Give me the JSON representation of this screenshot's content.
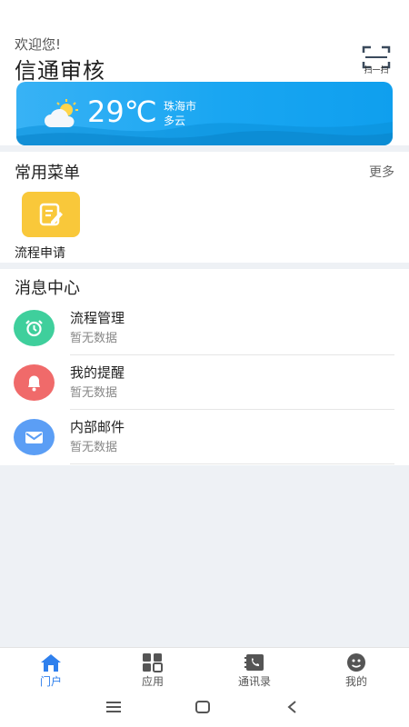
{
  "header": {
    "greeting": "欢迎您!",
    "title": "信通审核",
    "scan_label": "扫一扫"
  },
  "weather": {
    "temperature": "29℃",
    "city": "珠海市",
    "condition": "多云",
    "icon": "partly-cloudy-icon"
  },
  "menu_section": {
    "title": "常用菜单",
    "more_label": "更多",
    "items": [
      {
        "label": "流程申请",
        "icon": "edit-form-icon",
        "color": "#f9c83a"
      }
    ]
  },
  "message_section": {
    "title": "消息中心",
    "items": [
      {
        "title": "流程管理",
        "subtitle": "暂无数据",
        "icon": "alarm-clock-icon",
        "color": "#3fcf9c"
      },
      {
        "title": "我的提醒",
        "subtitle": "暂无数据",
        "icon": "bell-icon",
        "color": "#f06a6a"
      },
      {
        "title": "内部邮件",
        "subtitle": "暂无数据",
        "icon": "mail-icon",
        "color": "#5b9ef5"
      }
    ]
  },
  "tabbar": {
    "active_color": "#2f80ed",
    "tabs": [
      {
        "label": "门户",
        "icon": "home-icon",
        "active": true
      },
      {
        "label": "应用",
        "icon": "apps-grid-icon",
        "active": false
      },
      {
        "label": "通讯录",
        "icon": "contacts-icon",
        "active": false
      },
      {
        "label": "我的",
        "icon": "profile-icon",
        "active": false
      }
    ]
  },
  "system_nav": {
    "buttons": [
      "menu-icon",
      "home-square-icon",
      "back-icon"
    ]
  }
}
